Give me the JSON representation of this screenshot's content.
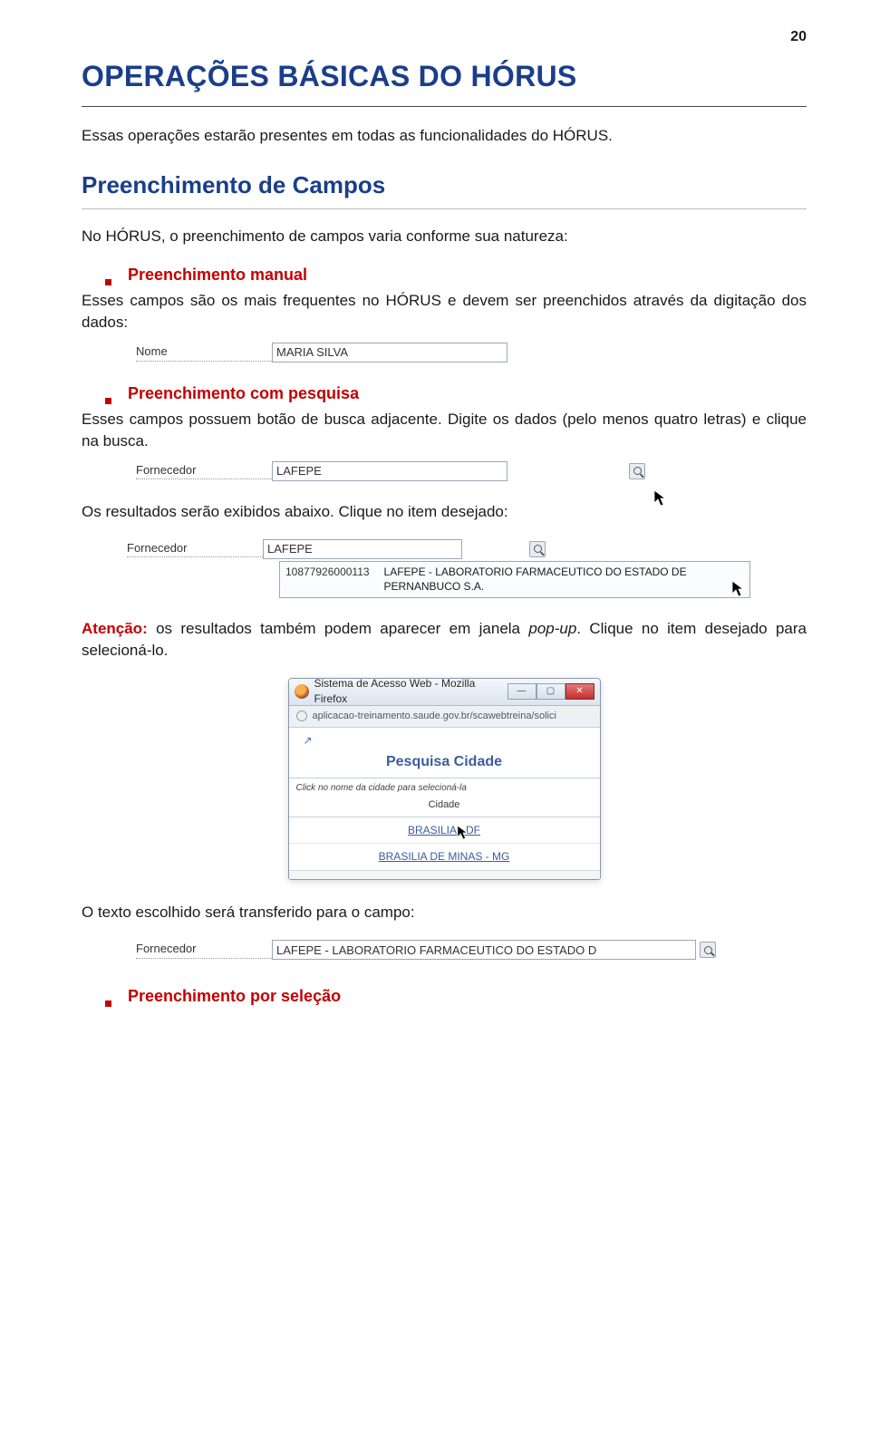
{
  "page_number": "20",
  "main_title": "OPERAÇÕES BÁSICAS DO HÓRUS",
  "intro": "Essas operações estarão presentes em todas as funcionalidades do HÓRUS.",
  "section1_title": "Preenchimento de Campos",
  "section1_text": "No HÓRUS, o preenchimento de campos varia conforme sua natureza:",
  "sub_manual_title": "Preenchimento manual",
  "sub_manual_text": "Esses campos são os mais frequentes no HÓRUS e devem ser preenchidos através da digitação dos dados:",
  "field_nome_label": "Nome",
  "field_nome_value": "MARIA SILVA",
  "sub_pesquisa_title": "Preenchimento com pesquisa",
  "sub_pesquisa_text": "Esses campos possuem botão de busca adjacente. Digite os dados (pelo menos quatro letras) e clique na busca.",
  "field_fornecedor_label": "Fornecedor",
  "field_fornecedor_value": "LAFEPE",
  "results_text": "Os resultados serão exibidos abaixo. Clique no item desejado:",
  "result_code": "10877926000113",
  "result_name": "LAFEPE - LABORATORIO FARMACEUTICO DO ESTADO DE PERNANBUCO S.A.",
  "atencao_label": "Atenção:",
  "atencao_text_1": " os resultados também podem aparecer em janela ",
  "atencao_italic": "pop-up",
  "atencao_text_2": ". Clique no item desejado para selecioná-lo.",
  "popup_window_title": "Sistema de Acesso Web - Mozilla Firefox",
  "popup_url": "aplicacao-treinamento.saude.gov.br/scawebtreina/solici",
  "popup_heading": "Pesquisa Cidade",
  "popup_hint": "Click no nome da cidade para selecioná-la",
  "popup_col": "Cidade",
  "popup_link1": "BRASILIA - DF",
  "popup_link2": "BRASILIA DE MINAS - MG",
  "transfer_text": "O texto escolhido será transferido para o campo:",
  "field_fornecedor_full": "LAFEPE - LABORATORIO FARMACEUTICO DO ESTADO D",
  "sub_selecao_title": "Preenchimento por seleção"
}
